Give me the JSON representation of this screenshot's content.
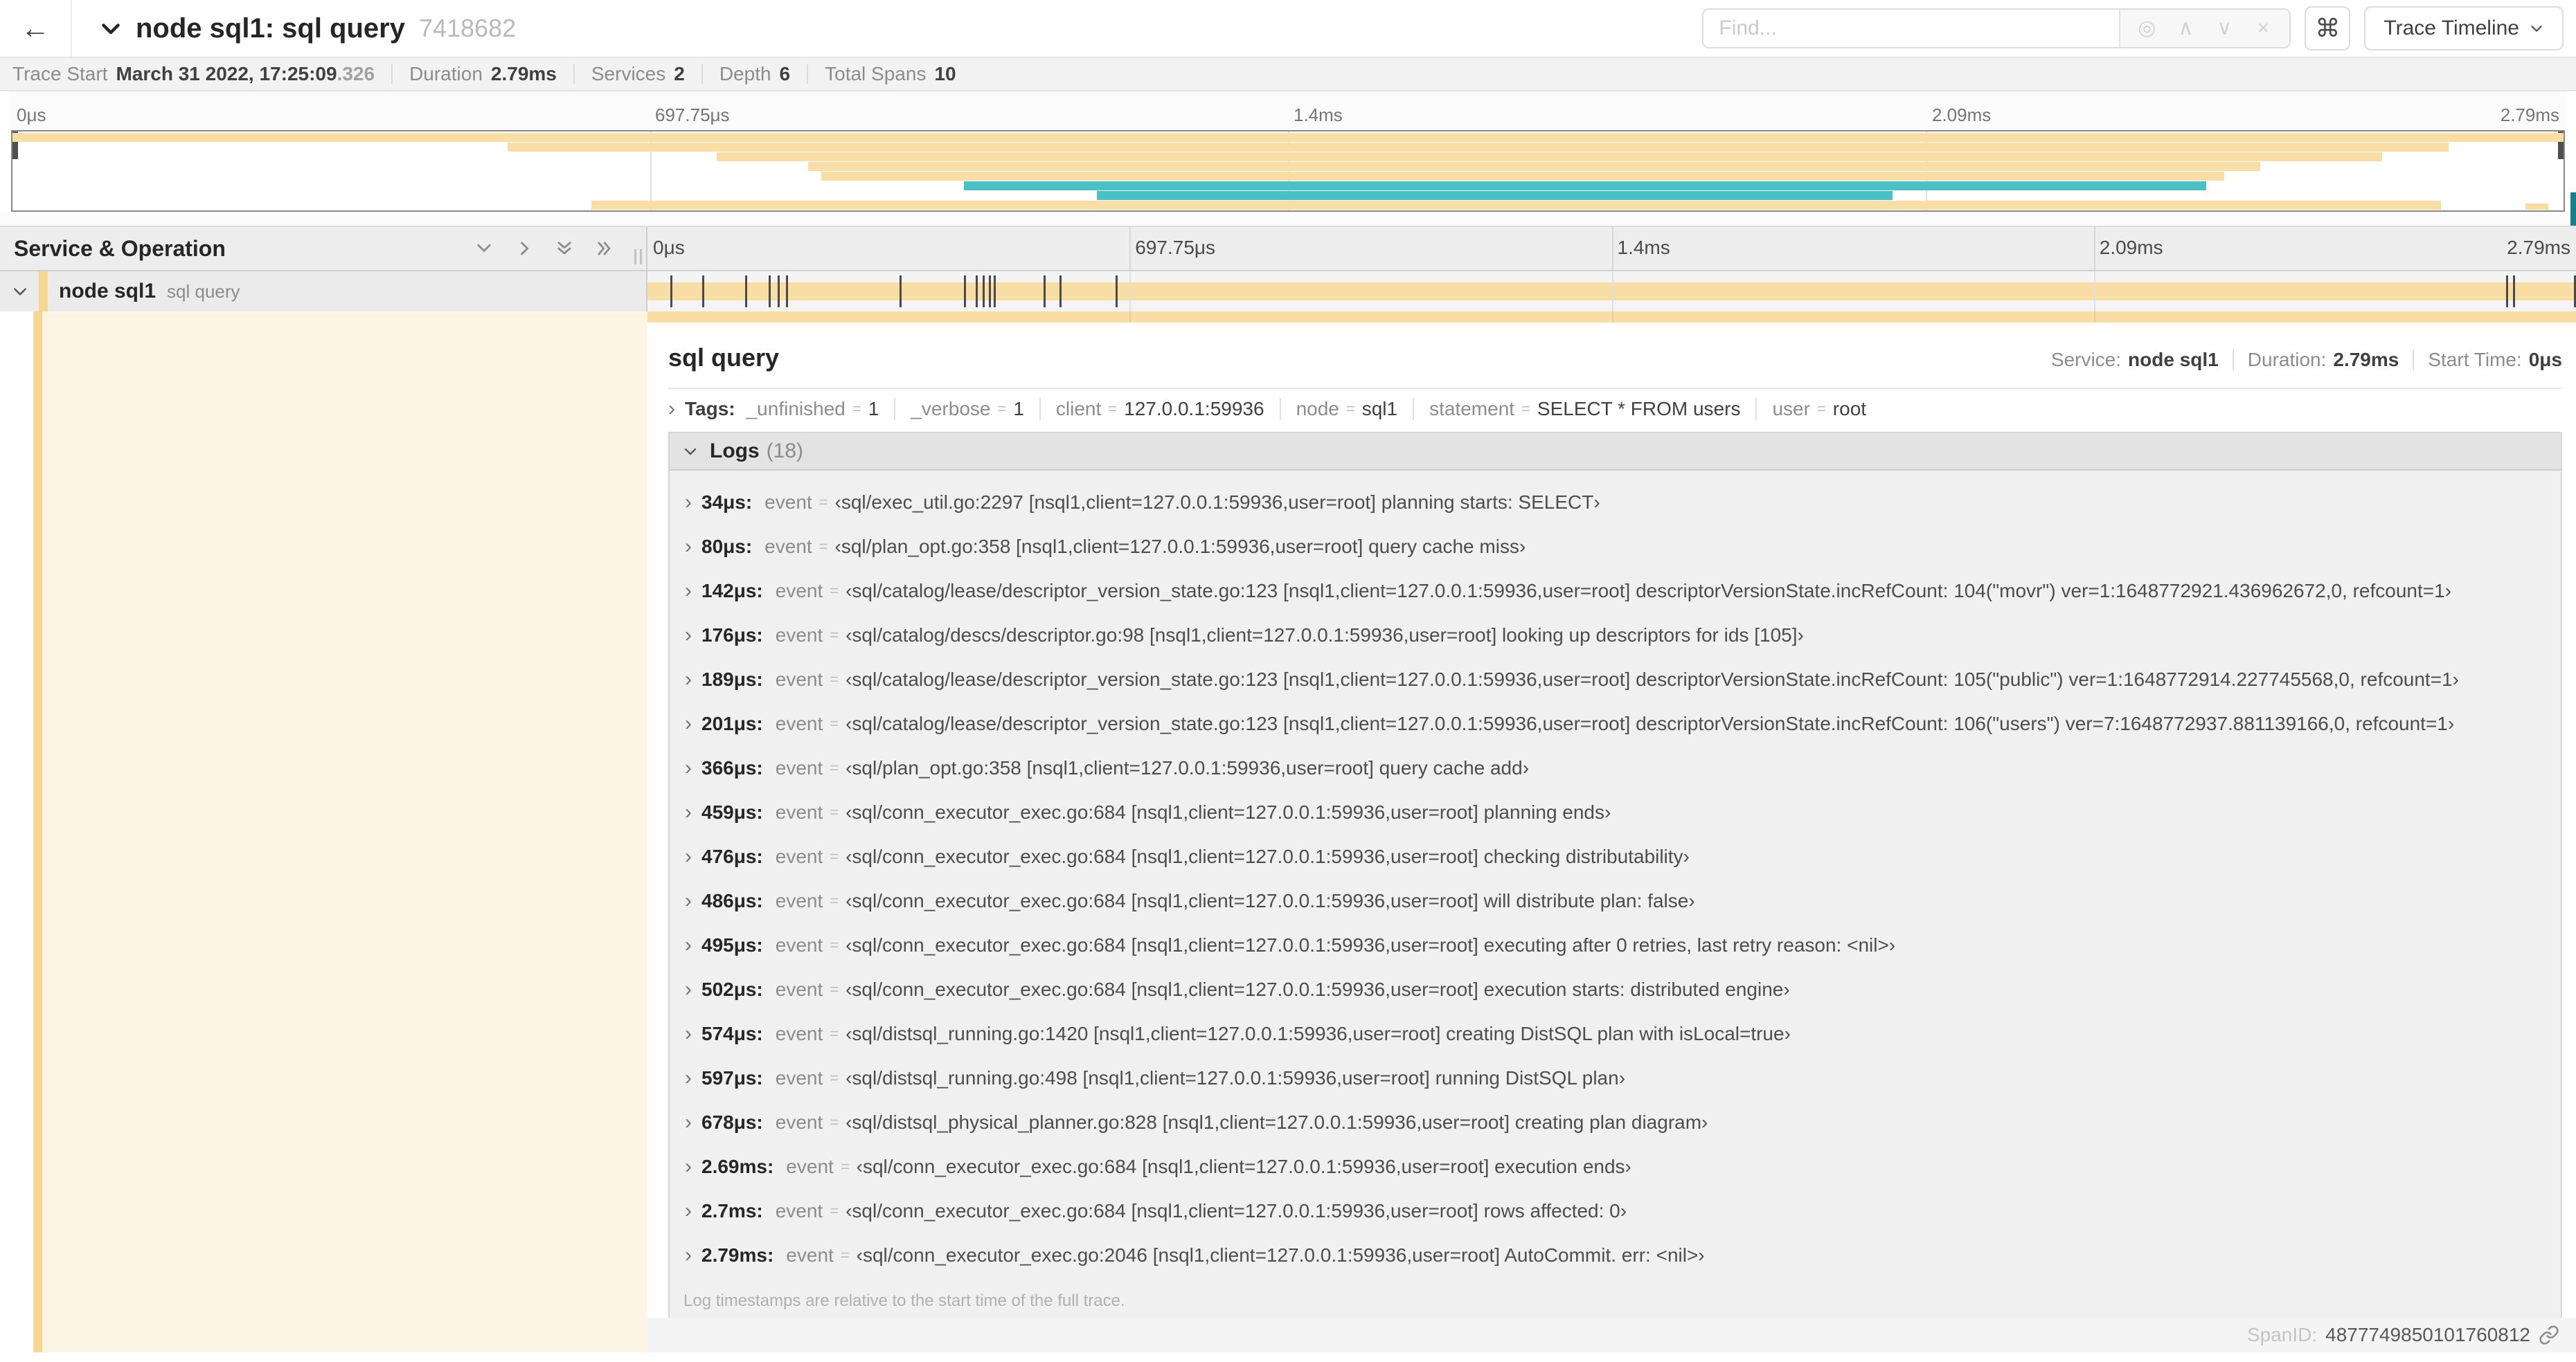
{
  "header": {
    "back_icon": "←",
    "title": "node sql1: sql query",
    "trace_id": "7418682",
    "find_placeholder": "Find...",
    "keyboard_shortcut": "⌘",
    "view_selector": "Trace Timeline"
  },
  "stats": [
    {
      "label": "Trace Start",
      "value": "March 31 2022, 17:25:09",
      "suffix": ".326"
    },
    {
      "label": "Duration",
      "value": "2.79ms"
    },
    {
      "label": "Services",
      "value": "2"
    },
    {
      "label": "Depth",
      "value": "6"
    },
    {
      "label": "Total Spans",
      "value": "10"
    }
  ],
  "timeline": {
    "tick_labels": [
      "0μs",
      "697.75μs",
      "1.4ms",
      "2.09ms",
      "2.79ms"
    ],
    "duration_us": 2790
  },
  "minimap": {
    "spans": [
      {
        "row": 0,
        "start_pct": 0,
        "end_pct": 100,
        "color": "tan"
      },
      {
        "row": 1,
        "start_pct": 19.4,
        "end_pct": 95.5,
        "color": "tan"
      },
      {
        "row": 2,
        "start_pct": 27.6,
        "end_pct": 92.9,
        "color": "tan"
      },
      {
        "row": 3,
        "start_pct": 31.2,
        "end_pct": 88.1,
        "color": "tan"
      },
      {
        "row": 4,
        "start_pct": 31.7,
        "end_pct": 86.7,
        "color": "tan"
      },
      {
        "row": 5,
        "start_pct": 37.3,
        "end_pct": 86.0,
        "color": "teal"
      },
      {
        "row": 6,
        "start_pct": 42.5,
        "end_pct": 73.7,
        "color": "teal"
      },
      {
        "row": 7,
        "start_pct": 22.7,
        "end_pct": 95.2,
        "color": "tan"
      },
      {
        "row": 8,
        "start_pct": 98.5,
        "end_pct": 99.4,
        "color": "tan"
      }
    ]
  },
  "left_panel": {
    "title": "Service & Operation"
  },
  "span_row": {
    "service": "node sql1",
    "operation": "sql query"
  },
  "detail": {
    "title": "sql query",
    "overview": [
      {
        "label": "Service:",
        "value": "node sql1"
      },
      {
        "label": "Duration:",
        "value": "2.79ms"
      },
      {
        "label": "Start Time:",
        "value": "0μs"
      }
    ],
    "tags_label": "Tags:",
    "tags": [
      {
        "key": "_unfinished",
        "value": "1"
      },
      {
        "key": "_verbose",
        "value": "1"
      },
      {
        "key": "client",
        "value": "127.0.0.1:59936"
      },
      {
        "key": "node",
        "value": "sql1"
      },
      {
        "key": "statement",
        "value": "SELECT * FROM users"
      },
      {
        "key": "user",
        "value": "root"
      }
    ],
    "logs_label": "Logs",
    "logs_count": "(18)",
    "logs": [
      {
        "ts": "34μs:",
        "ts_us": 34,
        "key": "event",
        "value": "‹sql/exec_util.go:2297 [nsql1,client=127.0.0.1:59936,user=root] planning starts: SELECT›"
      },
      {
        "ts": "80μs:",
        "ts_us": 80,
        "key": "event",
        "value": "‹sql/plan_opt.go:358 [nsql1,client=127.0.0.1:59936,user=root] query cache miss›"
      },
      {
        "ts": "142μs:",
        "ts_us": 142,
        "key": "event",
        "value": "‹sql/catalog/lease/descriptor_version_state.go:123 [nsql1,client=127.0.0.1:59936,user=root] descriptorVersionState.incRefCount: 104(\"movr\") ver=1:1648772921.436962672,0, refcount=1›"
      },
      {
        "ts": "176μs:",
        "ts_us": 176,
        "key": "event",
        "value": "‹sql/catalog/descs/descriptor.go:98 [nsql1,client=127.0.0.1:59936,user=root] looking up descriptors for ids [105]›"
      },
      {
        "ts": "189μs:",
        "ts_us": 189,
        "key": "event",
        "value": "‹sql/catalog/lease/descriptor_version_state.go:123 [nsql1,client=127.0.0.1:59936,user=root] descriptorVersionState.incRefCount: 105(\"public\") ver=1:1648772914.227745568,0, refcount=1›"
      },
      {
        "ts": "201μs:",
        "ts_us": 201,
        "key": "event",
        "value": "‹sql/catalog/lease/descriptor_version_state.go:123 [nsql1,client=127.0.0.1:59936,user=root] descriptorVersionState.incRefCount: 106(\"users\") ver=7:1648772937.881139166,0, refcount=1›"
      },
      {
        "ts": "366μs:",
        "ts_us": 366,
        "key": "event",
        "value": "‹sql/plan_opt.go:358 [nsql1,client=127.0.0.1:59936,user=root] query cache add›"
      },
      {
        "ts": "459μs:",
        "ts_us": 459,
        "key": "event",
        "value": "‹sql/conn_executor_exec.go:684 [nsql1,client=127.0.0.1:59936,user=root] planning ends›"
      },
      {
        "ts": "476μs:",
        "ts_us": 476,
        "key": "event",
        "value": "‹sql/conn_executor_exec.go:684 [nsql1,client=127.0.0.1:59936,user=root] checking distributability›"
      },
      {
        "ts": "486μs:",
        "ts_us": 486,
        "key": "event",
        "value": "‹sql/conn_executor_exec.go:684 [nsql1,client=127.0.0.1:59936,user=root] will distribute plan: false›"
      },
      {
        "ts": "495μs:",
        "ts_us": 495,
        "key": "event",
        "value": "‹sql/conn_executor_exec.go:684 [nsql1,client=127.0.0.1:59936,user=root] executing after 0 retries, last retry reason: <nil>›"
      },
      {
        "ts": "502μs:",
        "ts_us": 502,
        "key": "event",
        "value": "‹sql/conn_executor_exec.go:684 [nsql1,client=127.0.0.1:59936,user=root] execution starts: distributed engine›"
      },
      {
        "ts": "574μs:",
        "ts_us": 574,
        "key": "event",
        "value": "‹sql/distsql_running.go:1420 [nsql1,client=127.0.0.1:59936,user=root] creating DistSQL plan with isLocal=true›"
      },
      {
        "ts": "597μs:",
        "ts_us": 597,
        "key": "event",
        "value": "‹sql/distsql_running.go:498 [nsql1,client=127.0.0.1:59936,user=root] running DistSQL plan›"
      },
      {
        "ts": "678μs:",
        "ts_us": 678,
        "key": "event",
        "value": "‹sql/distsql_physical_planner.go:828 [nsql1,client=127.0.0.1:59936,user=root] creating plan diagram›"
      },
      {
        "ts": "2.69ms:",
        "ts_us": 2690,
        "key": "event",
        "value": "‹sql/conn_executor_exec.go:684 [nsql1,client=127.0.0.1:59936,user=root] execution ends›"
      },
      {
        "ts": "2.7ms:",
        "ts_us": 2700,
        "key": "event",
        "value": "‹sql/conn_executor_exec.go:684 [nsql1,client=127.0.0.1:59936,user=root] rows affected: 0›"
      },
      {
        "ts": "2.79ms:",
        "ts_us": 2790,
        "key": "event",
        "value": "‹sql/conn_executor_exec.go:2046 [nsql1,client=127.0.0.1:59936,user=root] AutoCommit. err: <nil>›"
      }
    ],
    "footnote": "Log timestamps are relative to the start time of the full trace.",
    "span_id_label": "SpanID:",
    "span_id": "4877749850101760812"
  },
  "colors": {
    "tan": "#F8DDA4",
    "teal": "#49C2C7",
    "stripe": "#F6D693",
    "cream": "#FDF5E4",
    "scroll_thumb": "#167F8C"
  }
}
